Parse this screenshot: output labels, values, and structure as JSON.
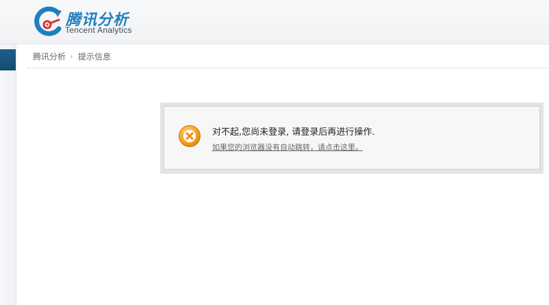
{
  "header": {
    "logo_cn": "腾讯分析",
    "logo_en": "Tencent Analytics"
  },
  "breadcrumb": {
    "home": "腾讯分析",
    "separator": "›",
    "current": "提示信息"
  },
  "message": {
    "icon": "error-x-icon",
    "title": "对不起,您尚未登录, 请登录后再进行操作.",
    "redirect_link": "如果您的浏览器没有自动跳转，请点击这里。"
  },
  "colors": {
    "brand_blue": "#1f7fc2",
    "brand_red": "#d9322b",
    "icon_orange": "#f5a623",
    "sidebar_active": "#1d5f8c"
  }
}
